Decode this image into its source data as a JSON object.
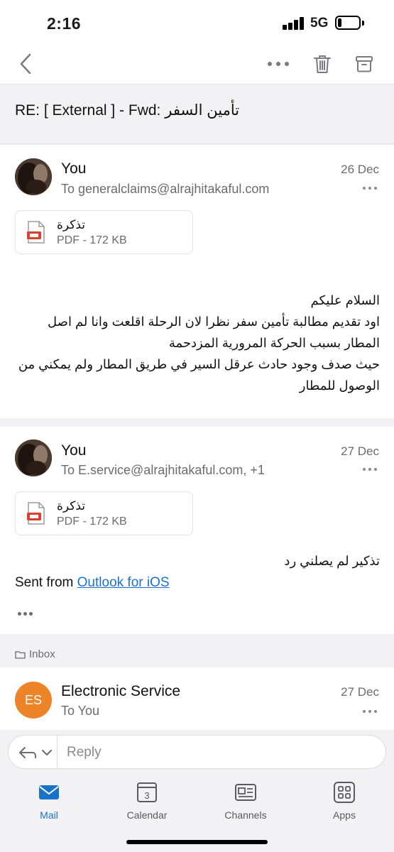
{
  "status_bar": {
    "time": "2:16",
    "network": "5G"
  },
  "nav": {
    "icons": [
      "back-chevron-icon",
      "more-icon",
      "trash-icon",
      "archive-icon"
    ]
  },
  "subject": "RE: [ External ] - Fwd: تأمين السفر",
  "messages": [
    {
      "sender": "You",
      "recipient": "To generalclaims@alrajhitakaful.com",
      "date": "26 Dec",
      "attachment": {
        "name": "تذكرة",
        "meta": "PDF - 172 KB"
      },
      "body_lines": [
        "السلام عليكم",
        "اود تقديم مطالبة تأمين سفر نظرا لان الرحلة اقلعت وانا لم اصل المطار بسبب الحركة المرورية المزدحمة",
        "حيث صدف وجود حادث عرقل السير في طريق المطار ولم يمكني من الوصول للمطار"
      ]
    },
    {
      "sender": "You",
      "recipient": "To E.service@alrajhitakaful.com, +1",
      "date": "27 Dec",
      "attachment": {
        "name": "تذكرة",
        "meta": "PDF - 172 KB"
      },
      "body_line": "تذكير لم يصلني رد",
      "signature_prefix": "Sent from",
      "signature_link": "Outlook for iOS"
    }
  ],
  "folder_label": "Inbox",
  "last_message": {
    "avatar_initials": "ES",
    "avatar_color": "#ee8429",
    "sender": "Electronic Service",
    "recipient": "To You",
    "date": "27 Dec"
  },
  "reply": {
    "label": "Reply"
  },
  "tabs": [
    {
      "label": "Mail",
      "icon": "mail-icon",
      "active": true
    },
    {
      "label": "Calendar",
      "icon": "calendar-icon",
      "day": "3"
    },
    {
      "label": "Channels",
      "icon": "channels-icon"
    },
    {
      "label": "Apps",
      "icon": "apps-icon"
    }
  ],
  "colors": {
    "accent": "#1a73c9",
    "pdf_red": "#d9412e"
  }
}
